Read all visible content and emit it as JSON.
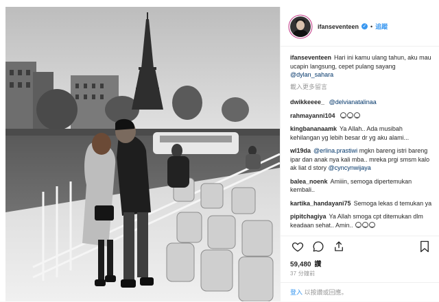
{
  "post": {
    "username": "ifanseventeen",
    "verified": true,
    "follow_label": "追蹤",
    "caption": {
      "user": "ifanseventeen",
      "text": "Hari ini kamu ulang tahun, aku mau ucapin langsung, cepet pulang sayang",
      "mention": "@dylan_sahara"
    },
    "load_more": "載入更多留言",
    "comments": [
      {
        "user": "dwikkeeee_",
        "text": "",
        "mention": "@delvianatalinaa",
        "emoji_count": 0
      },
      {
        "user": "rahmayanni104",
        "text": "",
        "mention": "",
        "emoji_count": 3
      },
      {
        "user": "kingbananaamk",
        "text": "Ya Allah.. Ada musibah kehilangan yg lebih besar dr yg aku alami...",
        "mention": "",
        "emoji_count": 0
      },
      {
        "user": "wl19da",
        "text": "mgkn bareng istri bareng ipar dan anak nya kali mba.. mreka prgi smsm kalo ak liat d story",
        "mention": "@erlina.prastiwi",
        "mention2": "@cyncynwijaya",
        "emoji_count": 0
      },
      {
        "user": "balea_noenk",
        "text": "Amiiin, semoga dipertemukan kembali..",
        "mention": "",
        "emoji_count": 0
      },
      {
        "user": "kartika_handayani75",
        "text": "Semoga lekas d temukan ya",
        "mention": "",
        "emoji_count": 0
      },
      {
        "user": "pipitchagiya",
        "text": "Ya Allah smoga cpt ditemukan dlm keadaan sehat.. Amin..",
        "mention": "",
        "emoji_count": 3
      }
    ],
    "likes_count": "59,480",
    "likes_label": "讚",
    "time_ago": "37 分鐘前",
    "login_prompt": "登入",
    "login_suffix": "以按讚或回應。",
    "icons": [
      "heart-icon",
      "comment-icon",
      "share-icon",
      "bookmark-icon",
      "verified-badge-icon"
    ],
    "colors": {
      "link": "#3897f0",
      "mention": "#003569",
      "muted": "#999999",
      "text": "#262626"
    }
  }
}
